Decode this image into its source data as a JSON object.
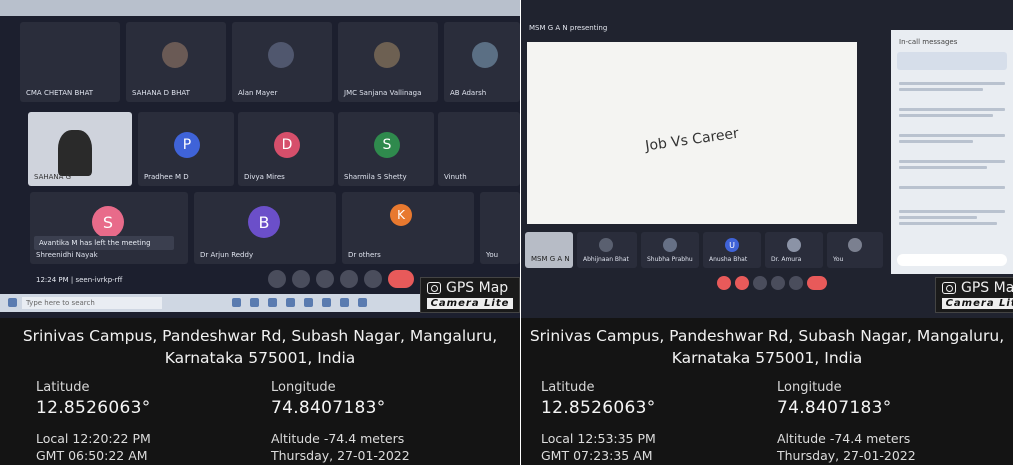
{
  "left": {
    "participants": [
      {
        "name": "CMA CHETAN BHAT"
      },
      {
        "name": "SAHANA D BHAT"
      },
      {
        "name": "Alan Mayer"
      },
      {
        "name": "JMC Sanjana Vallinaga"
      },
      {
        "name": "AB Adarsh"
      },
      {
        "name": "SAHANA G"
      },
      {
        "name": "Pradhee M D",
        "initial": "P"
      },
      {
        "name": "Divya Mires",
        "initial": "D"
      },
      {
        "name": "Sharmila S Shetty",
        "initial": "S"
      },
      {
        "name": "Vinuth"
      },
      {
        "name": "Shreenidhi Nayak",
        "initial": "S"
      },
      {
        "name": "Dr Arjun Reddy",
        "initial": "B"
      },
      {
        "name": "Dr others",
        "initial": "K"
      },
      {
        "name": "You"
      }
    ],
    "notification": "Avantika M has left the meeting",
    "meeting_time": "12:24 PM | seen-ivrkp-rff",
    "search_placeholder": "Type here to search",
    "address": "Srinivas Campus, Pandeshwar Rd, Subash Nagar, Mangaluru, Karnataka 575001, India",
    "latitude_label": "Latitude",
    "latitude": "12.8526063°",
    "longitude_label": "Longitude",
    "longitude": "74.8407183°",
    "local_time": "Local 12:20:22 PM",
    "gmt_time": "GMT 06:50:22 AM",
    "altitude": "Altitude -74.4 meters",
    "date": "Thursday, 27-01-2022"
  },
  "right": {
    "presenting": "MSM G A N presenting",
    "slide_text": "Job Vs Career",
    "chat_title": "In-call messages",
    "participants": [
      {
        "name": "MSM G A N"
      },
      {
        "name": "Abhijnaan Bhat"
      },
      {
        "name": "Shubha Prabhu"
      },
      {
        "name": "Anusha Bhat",
        "initial": "U"
      },
      {
        "name": "Dr. Amura"
      },
      {
        "name": "You"
      }
    ],
    "address": "Srinivas Campus, Pandeshwar Rd, Subash Nagar, Mangaluru, Karnataka 575001, India",
    "latitude_label": "Latitude",
    "latitude": "12.8526063°",
    "longitude_label": "Longitude",
    "longitude": "74.8407183°",
    "local_time": "Local 12:53:35 PM",
    "gmt_time": "GMT 07:23:35 AM",
    "altitude": "Altitude -74.4 meters",
    "date": "Thursday, 27-01-2022"
  },
  "watermark": {
    "title": "GPS Map",
    "subtitle": "Camera Lite"
  }
}
